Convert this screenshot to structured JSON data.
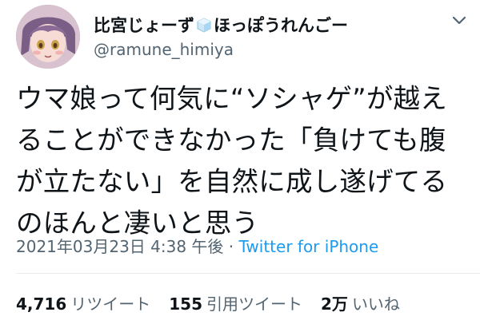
{
  "user": {
    "display_name_part1": "比宮じょーず",
    "display_name_emoji": "ice-cube-emoji",
    "display_name_part2": "ほっぽうれんごー",
    "handle": "@ramune_himiya"
  },
  "tweet": {
    "text": "ウマ娘って何気に“ソシャゲ”が越えることができなかった「負けても腹が立たない」を自然に成し遂げてるのほんと凄いと思う"
  },
  "meta": {
    "timestamp": "2021年03月23日 4:38 午後",
    "separator": " · ",
    "source": "Twitter for iPhone"
  },
  "stats": {
    "retweets_count": "4,716",
    "retweets_label": "リツイート",
    "quotes_count": "155",
    "quotes_label": "引用ツイート",
    "likes_count": "2万",
    "likes_label": "いいね"
  },
  "colors": {
    "text": "#0f1419",
    "secondary": "#536471",
    "link": "#1d9bf0",
    "divider": "#e6ecf0"
  }
}
